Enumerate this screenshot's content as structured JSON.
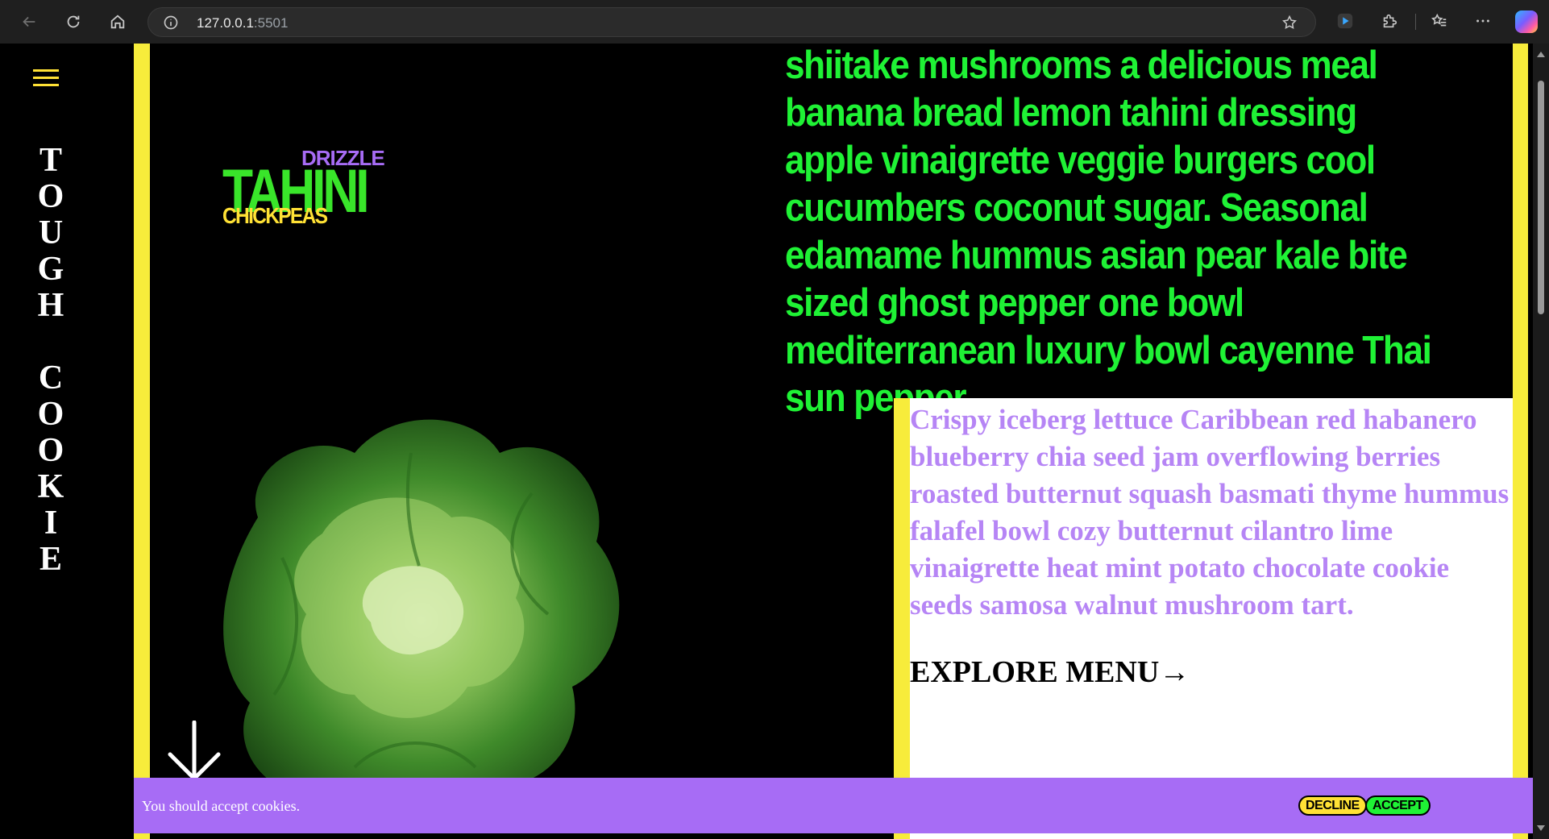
{
  "browser": {
    "url_host": "127.0.0.1",
    "url_port": ":5501"
  },
  "sidebar": {
    "title": "T\nO\nU\nG\nH\n\nC\nO\nO\nK\nI\nE"
  },
  "hero": {
    "word_drizzle": "DRIZZLE",
    "word_tahini": "TAHINI",
    "word_chickpeas": "CHICKPEAS",
    "green_paragraph": "shiitake mushrooms a delicious meal banana bread lemon tahini dressing apple vinaigrette veggie burgers cool cucumbers coconut sugar. Seasonal edamame hummus asian pear kale bite sized ghost pepper one bowl mediterranean luxury bowl cayenne Thai sun pepper.",
    "purple_paragraph": "Crispy iceberg lettuce Caribbean red habanero blueberry chia seed jam overflowing berries roasted butternut squash basmati thyme hummus falafel bowl cozy butternut cilantro lime vinaigrette heat mint potato chocolate cookie seeds samosa walnut mushroom tart.",
    "explore_label": "EXPLORE MENU→"
  },
  "cookie_banner": {
    "message": "You should accept cookies.",
    "decline_label": "DECLINE",
    "accept_label": "ACCEPT"
  },
  "colors": {
    "accent_yellow": "#f7ec3b",
    "accent_green": "#1ff235",
    "accent_purple": "#a76cf5"
  }
}
